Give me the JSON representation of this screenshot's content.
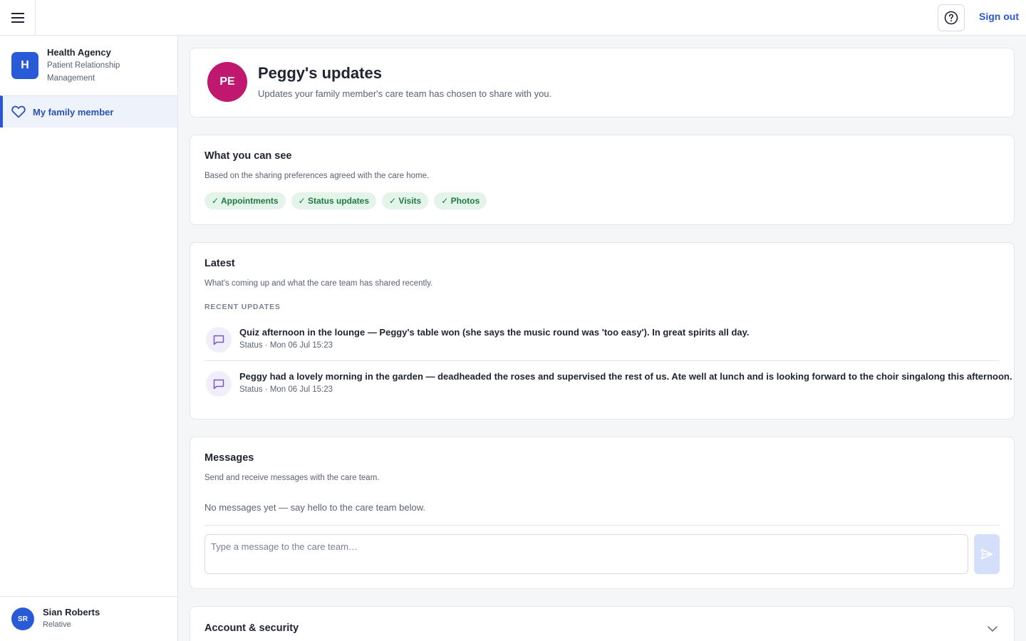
{
  "topbar": {
    "menu_icon": "hamburger-menu-icon",
    "help_icon": "question-circle-icon",
    "signout_label": "Sign out",
    "accent_color": "#2a55d4"
  },
  "sidebar": {
    "org": {
      "initial": "H",
      "name": "Health Agency",
      "subtitle": "Patient Relationship Management"
    },
    "items": [
      {
        "label": "My family member",
        "icon": "heart-icon",
        "active": true
      }
    ],
    "user": {
      "initials": "SR",
      "name": "Sian Roberts",
      "role": "Relative"
    }
  },
  "hero": {
    "initials": "PE",
    "avatar_color": "#c0176f",
    "title": "Peggy's updates",
    "subtitle": "Updates your family member's care team has chosen to share with you."
  },
  "visibility": {
    "title": "What you can see",
    "subtitle": "Based on the sharing preferences agreed with the care home.",
    "chips": [
      "✓ Appointments",
      "✓ Status updates",
      "✓ Visits",
      "✓ Photos"
    ]
  },
  "latest": {
    "title": "Latest",
    "subtitle": "What's coming up and what the care team has shared recently.",
    "section_label": "RECENT UPDATES",
    "updates": [
      {
        "icon": "message-square-icon",
        "text": "Quiz afternoon in the lounge — Peggy's table won (she says the music round was 'too easy'). In great spirits all day.",
        "meta": "Status · Mon 06 Jul 15:23"
      },
      {
        "icon": "message-square-icon",
        "text": "Peggy had a lovely morning in the garden — deadheaded the roses and supervised the rest of us. Ate well at lunch and is looking forward to the choir singalong this afternoon.",
        "meta": "Status · Mon 06 Jul 15:23"
      }
    ]
  },
  "messages": {
    "title": "Messages",
    "subtitle": "Send and receive messages with the care team.",
    "empty_text": "No messages yet — say hello to the care team below.",
    "input_value": "",
    "input_placeholder": "Type a message to the care team…",
    "send_icon": "send-icon"
  },
  "account": {
    "title": "Account & security",
    "expand_icon": "chevron-down-icon"
  }
}
